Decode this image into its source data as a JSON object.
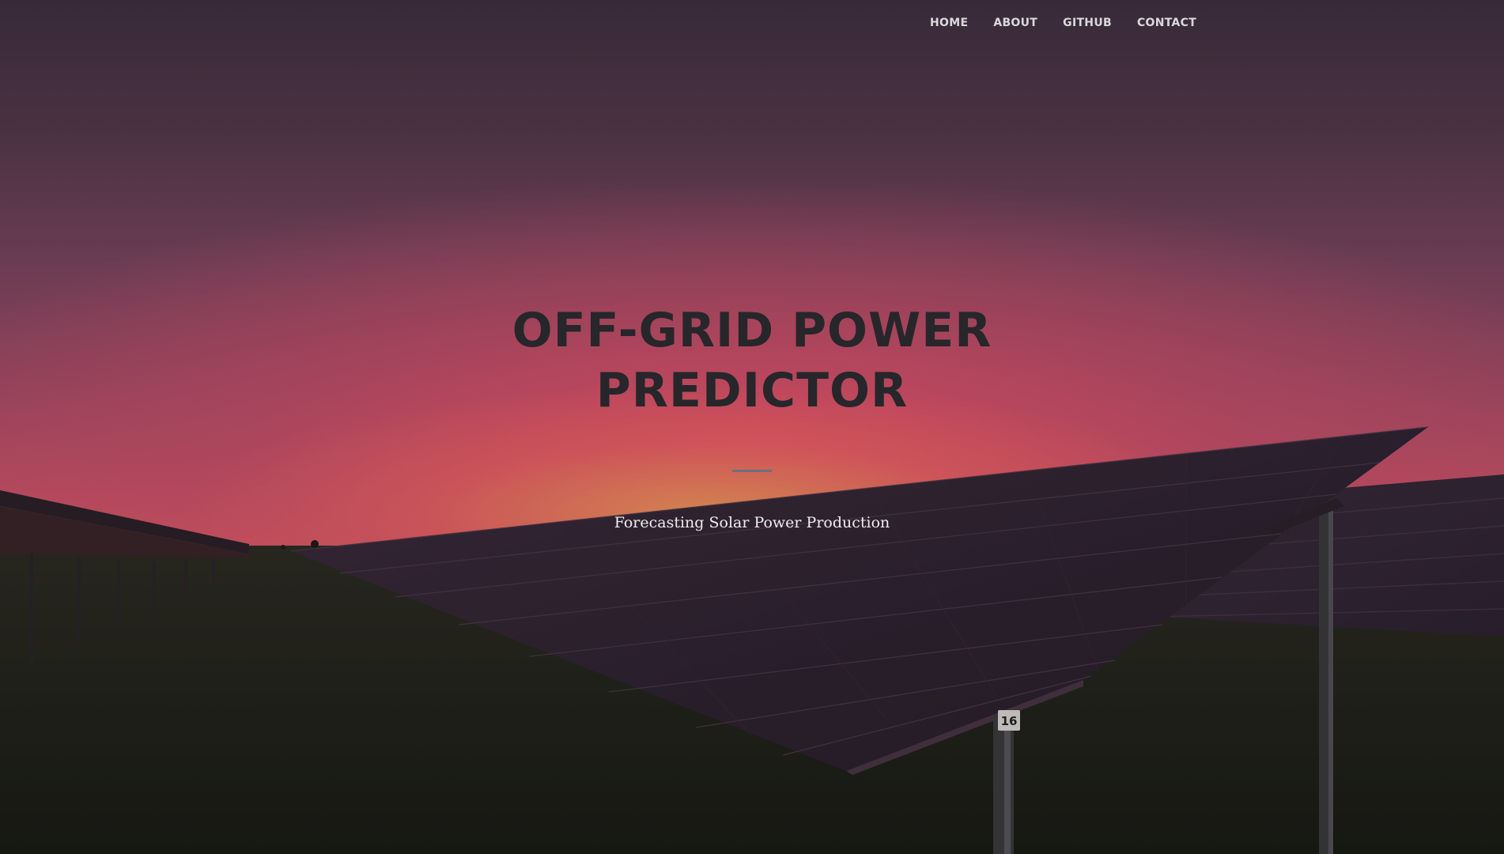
{
  "navbar": {
    "items": [
      {
        "label": "HOME"
      },
      {
        "label": "ABOUT"
      },
      {
        "label": "GITHUB"
      },
      {
        "label": "CONTACT"
      }
    ]
  },
  "masthead": {
    "title_line1": "OFF-GRID POWER",
    "title_line2": "PREDICTOR",
    "subtitle": "Forecasting Solar Power Production"
  },
  "background": {
    "panel_tag": "16"
  },
  "colors": {
    "title": "#27262b",
    "divider": "#6b6f82",
    "nav_text": "#ffffff"
  }
}
